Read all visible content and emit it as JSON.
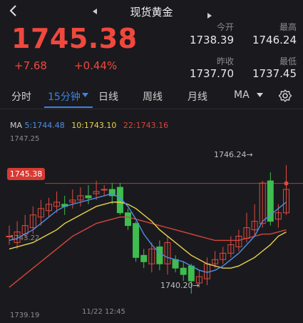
{
  "header": {
    "title": "现货黄金"
  },
  "quote": {
    "price": "1745.38",
    "change": "+7.68",
    "change_pct": "+0.44%",
    "up_color": "#f0483e"
  },
  "stats": {
    "open_label": "今开",
    "open": "1738.39",
    "high_label": "最高",
    "high": "1746.24",
    "prev_close_label": "昨收",
    "prev_close": "1737.70",
    "low_label": "最低",
    "low": "1737.45"
  },
  "tabs": [
    "分时",
    "15分钟",
    "日线",
    "周线",
    "月线",
    "MA"
  ],
  "active_tab": "15分钟",
  "ma": {
    "prefix": "MA",
    "ma5": "5:1744.48",
    "ma10": "10:1743.10",
    "ma22": "22:1743.16",
    "colors": {
      "ma5": "#4e8fe8",
      "ma10": "#e8d24e",
      "ma22": "#d8453b"
    }
  },
  "chart_data": {
    "type": "candlestick",
    "y_labels": [
      "1747.25",
      "1743.22",
      "1739.19"
    ],
    "x_labels": [
      "11/22 12:45"
    ],
    "current_price_tag": "1745.38",
    "high_marker": "1746.24→",
    "low_marker": "1740.20→",
    "ylim": [
      1739.19,
      1747.25
    ],
    "colors": {
      "up": "#e14a3f",
      "down": "#3fbd4f"
    },
    "candles": [
      {
        "o": 1742.9,
        "c": 1742.9,
        "h": 1743.4,
        "l": 1742.5
      },
      {
        "o": 1742.6,
        "c": 1743.1,
        "h": 1743.6,
        "l": 1742.3
      },
      {
        "o": 1743.0,
        "c": 1743.4,
        "h": 1743.9,
        "l": 1742.8
      },
      {
        "o": 1743.3,
        "c": 1743.9,
        "h": 1744.3,
        "l": 1743.0
      },
      {
        "o": 1743.8,
        "c": 1744.2,
        "h": 1744.6,
        "l": 1743.4
      },
      {
        "o": 1744.1,
        "c": 1744.4,
        "h": 1744.7,
        "l": 1743.8
      },
      {
        "o": 1744.3,
        "c": 1744.5,
        "h": 1745.0,
        "l": 1744.0
      },
      {
        "o": 1744.4,
        "c": 1744.3,
        "h": 1744.8,
        "l": 1743.9
      },
      {
        "o": 1744.5,
        "c": 1744.6,
        "h": 1745.1,
        "l": 1744.2
      },
      {
        "o": 1744.6,
        "c": 1744.8,
        "h": 1745.2,
        "l": 1744.3
      },
      {
        "o": 1744.8,
        "c": 1744.7,
        "h": 1745.3,
        "l": 1744.4
      },
      {
        "o": 1744.9,
        "c": 1745.0,
        "h": 1745.5,
        "l": 1744.6
      },
      {
        "o": 1745.1,
        "c": 1745.1,
        "h": 1745.3,
        "l": 1744.8
      },
      {
        "o": 1745.1,
        "c": 1744.8,
        "h": 1745.4,
        "l": 1744.4
      },
      {
        "o": 1745.2,
        "c": 1744.0,
        "h": 1745.4,
        "l": 1743.9
      },
      {
        "o": 1744.0,
        "c": 1743.4,
        "h": 1744.2,
        "l": 1743.2
      },
      {
        "o": 1743.5,
        "c": 1741.9,
        "h": 1743.6,
        "l": 1741.7
      },
      {
        "o": 1742.0,
        "c": 1741.7,
        "h": 1742.3,
        "l": 1741.4
      },
      {
        "o": 1741.6,
        "c": 1742.3,
        "h": 1742.6,
        "l": 1741.2
      },
      {
        "o": 1742.4,
        "c": 1741.6,
        "h": 1742.7,
        "l": 1741.3
      },
      {
        "o": 1741.6,
        "c": 1742.6,
        "h": 1742.9,
        "l": 1741.1
      },
      {
        "o": 1741.8,
        "c": 1741.4,
        "h": 1742.0,
        "l": 1741.2
      },
      {
        "o": 1741.4,
        "c": 1741.1,
        "h": 1741.7,
        "l": 1740.8
      },
      {
        "o": 1741.5,
        "c": 1740.8,
        "h": 1741.6,
        "l": 1740.2
      },
      {
        "o": 1740.7,
        "c": 1741.0,
        "h": 1741.3,
        "l": 1740.5
      },
      {
        "o": 1740.9,
        "c": 1741.6,
        "h": 1741.9,
        "l": 1740.6
      },
      {
        "o": 1741.6,
        "c": 1741.8,
        "h": 1742.2,
        "l": 1741.4
      },
      {
        "o": 1741.8,
        "c": 1742.1,
        "h": 1742.4,
        "l": 1741.6
      },
      {
        "o": 1742.1,
        "c": 1742.5,
        "h": 1742.9,
        "l": 1741.9
      },
      {
        "o": 1742.4,
        "c": 1742.9,
        "h": 1743.2,
        "l": 1742.2
      },
      {
        "o": 1742.8,
        "c": 1743.3,
        "h": 1744.0,
        "l": 1742.6
      },
      {
        "o": 1743.2,
        "c": 1743.6,
        "h": 1744.4,
        "l": 1742.9
      },
      {
        "o": 1743.5,
        "c": 1745.4,
        "h": 1745.5,
        "l": 1743.3
      },
      {
        "o": 1745.5,
        "c": 1743.6,
        "h": 1745.9,
        "l": 1743.4
      },
      {
        "o": 1743.7,
        "c": 1744.0,
        "h": 1744.4,
        "l": 1743.3
      },
      {
        "o": 1744.0,
        "c": 1745.1,
        "h": 1746.24,
        "l": 1743.9
      }
    ],
    "ma5": [
      1742.7,
      1742.8,
      1743.0,
      1743.2,
      1743.5,
      1743.8,
      1744.1,
      1744.3,
      1744.4,
      1744.5,
      1744.6,
      1744.7,
      1744.8,
      1744.9,
      1744.7,
      1744.3,
      1743.7,
      1743.0,
      1742.5,
      1742.1,
      1741.9,
      1741.8,
      1741.7,
      1741.5,
      1741.3,
      1741.2,
      1741.3,
      1741.5,
      1741.8,
      1742.1,
      1742.5,
      1742.9,
      1743.6,
      1743.9,
      1744.2,
      1744.5
    ],
    "ma10": [
      1742.3,
      1742.4,
      1742.5,
      1742.6,
      1742.8,
      1743.0,
      1743.2,
      1743.5,
      1743.7,
      1743.9,
      1744.1,
      1744.3,
      1744.4,
      1744.5,
      1744.5,
      1744.4,
      1744.2,
      1743.9,
      1743.6,
      1743.2,
      1742.9,
      1742.6,
      1742.3,
      1742.0,
      1741.8,
      1741.6,
      1741.5,
      1741.4,
      1741.4,
      1741.5,
      1741.7,
      1741.9,
      1742.2,
      1742.5,
      1742.9,
      1743.1
    ],
    "ma22": [
      1740.5,
      1740.8,
      1741.1,
      1741.4,
      1741.7,
      1742.0,
      1742.3,
      1742.6,
      1742.9,
      1743.1,
      1743.3,
      1743.5,
      1743.6,
      1743.7,
      1743.8,
      1743.8,
      1743.7,
      1743.6,
      1743.5,
      1743.4,
      1743.3,
      1743.2,
      1743.1,
      1743.0,
      1742.9,
      1742.8,
      1742.7,
      1742.7,
      1742.7,
      1742.7,
      1742.8,
      1742.9,
      1743.0,
      1743.0,
      1743.1,
      1743.2
    ]
  }
}
